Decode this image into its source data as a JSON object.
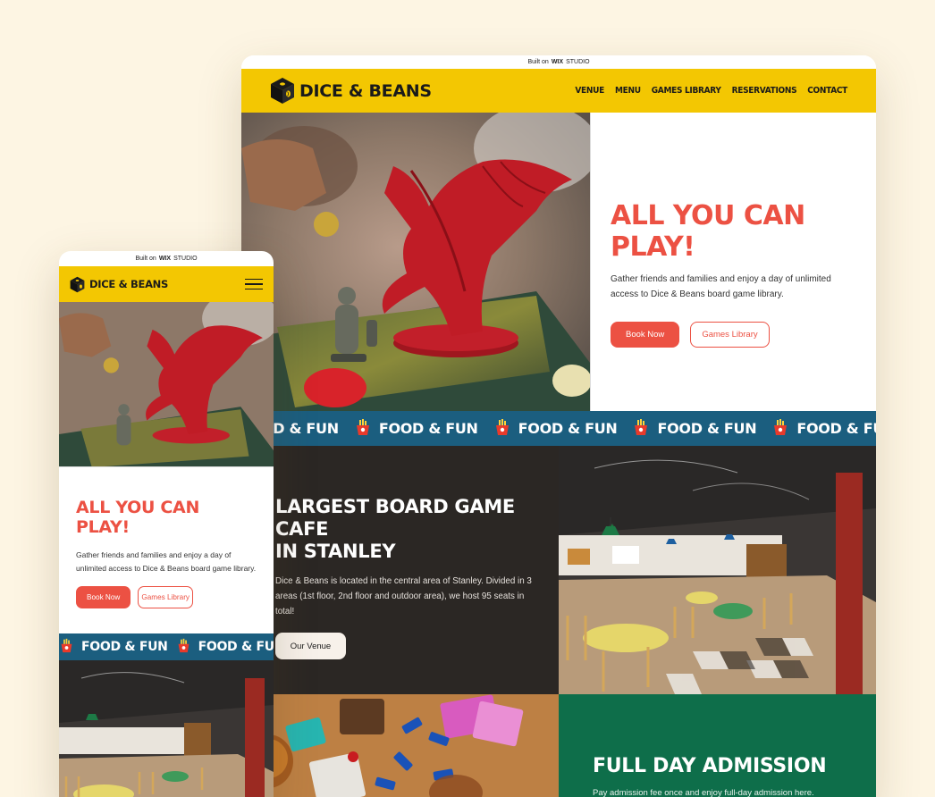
{
  "built_on": {
    "prefix": "Built on",
    "brand": "WIX",
    "suffix": "STUDIO"
  },
  "brand": {
    "name": "DICE & BEANS"
  },
  "colors": {
    "yellow": "#f3c702",
    "coral": "#ec5143",
    "teal": "#1b5e7f",
    "dark": "#2b2724",
    "green": "#0e6e4a",
    "page_bg": "#fdf5e3"
  },
  "nav": {
    "items": [
      {
        "label": "VENUE"
      },
      {
        "label": "MENU"
      },
      {
        "label": "GAMES LIBRARY"
      },
      {
        "label": "RESERVATIONS"
      },
      {
        "label": "CONTACT"
      }
    ]
  },
  "hero": {
    "title": "ALL YOU CAN PLAY!",
    "text": "Gather friends and families and enjoy a day of unlimited access to Dice & Beans board game library.",
    "book_label": "Book Now",
    "library_label": "Games Library"
  },
  "marquee": {
    "text": "FOOD & FUN",
    "icon": "fries-icon"
  },
  "venue": {
    "title_line1": "LARGEST BOARD GAME CAFE",
    "title_line2": "IN STANLEY",
    "text": "Dice & Beans is located in the central area of Stanley. Divided in 3 areas (1st floor, 2nd floor and outdoor area), we host 95 seats in total!",
    "button_label": "Our Venue"
  },
  "admission": {
    "title": "FULL DAY ADMISSION",
    "text": "Pay admission fee once and enjoy full-day admission here."
  },
  "mobile": {
    "menu_icon": "hamburger-menu-icon"
  }
}
